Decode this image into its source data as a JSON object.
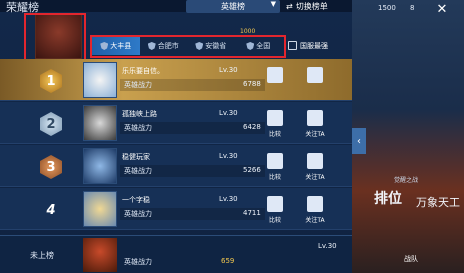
{
  "header": {
    "board_title": "荣耀榜",
    "category": "英雄榜",
    "switch_label": "切换榜单",
    "hero_label": "",
    "hero_line": "",
    "requirement_label": "",
    "requirement_value": "1000"
  },
  "region_tabs": [
    {
      "label": "大丰县",
      "active": true
    },
    {
      "label": "合肥市",
      "active": false
    },
    {
      "label": "安徽省",
      "active": false
    },
    {
      "label": "全国",
      "active": false
    }
  ],
  "national_label": "国服最强",
  "rows": [
    {
      "rank": "1",
      "name": "乐乐要自信。",
      "level": "Lv.30",
      "power_label": "英雄战力",
      "power": "6788",
      "btn1": "",
      "btn2": ""
    },
    {
      "rank": "2",
      "name": "孤独峡上路",
      "level": "Lv.30",
      "power_label": "英雄战力",
      "power": "6428",
      "btn1": "比较",
      "btn2": "关注TA"
    },
    {
      "rank": "3",
      "name": "稳健玩家",
      "level": "Lv.30",
      "power_label": "英雄战力",
      "power": "5266",
      "btn1": "比较",
      "btn2": "关注TA"
    },
    {
      "rank": "4",
      "name": "一个字稳",
      "level": "Lv.30",
      "power_label": "英雄战力",
      "power": "4711",
      "btn1": "比较",
      "btn2": "关注TA"
    }
  ],
  "self": {
    "rank_text": "未上榜",
    "name": "",
    "level": "Lv.30",
    "power_label": "英雄战力",
    "power": "659"
  },
  "right_panel": {
    "num1": "1500",
    "num2": "8",
    "ranking": "排位",
    "wanxiang": "万象天工",
    "battle": "战队",
    "tag": "觉醒之战"
  }
}
